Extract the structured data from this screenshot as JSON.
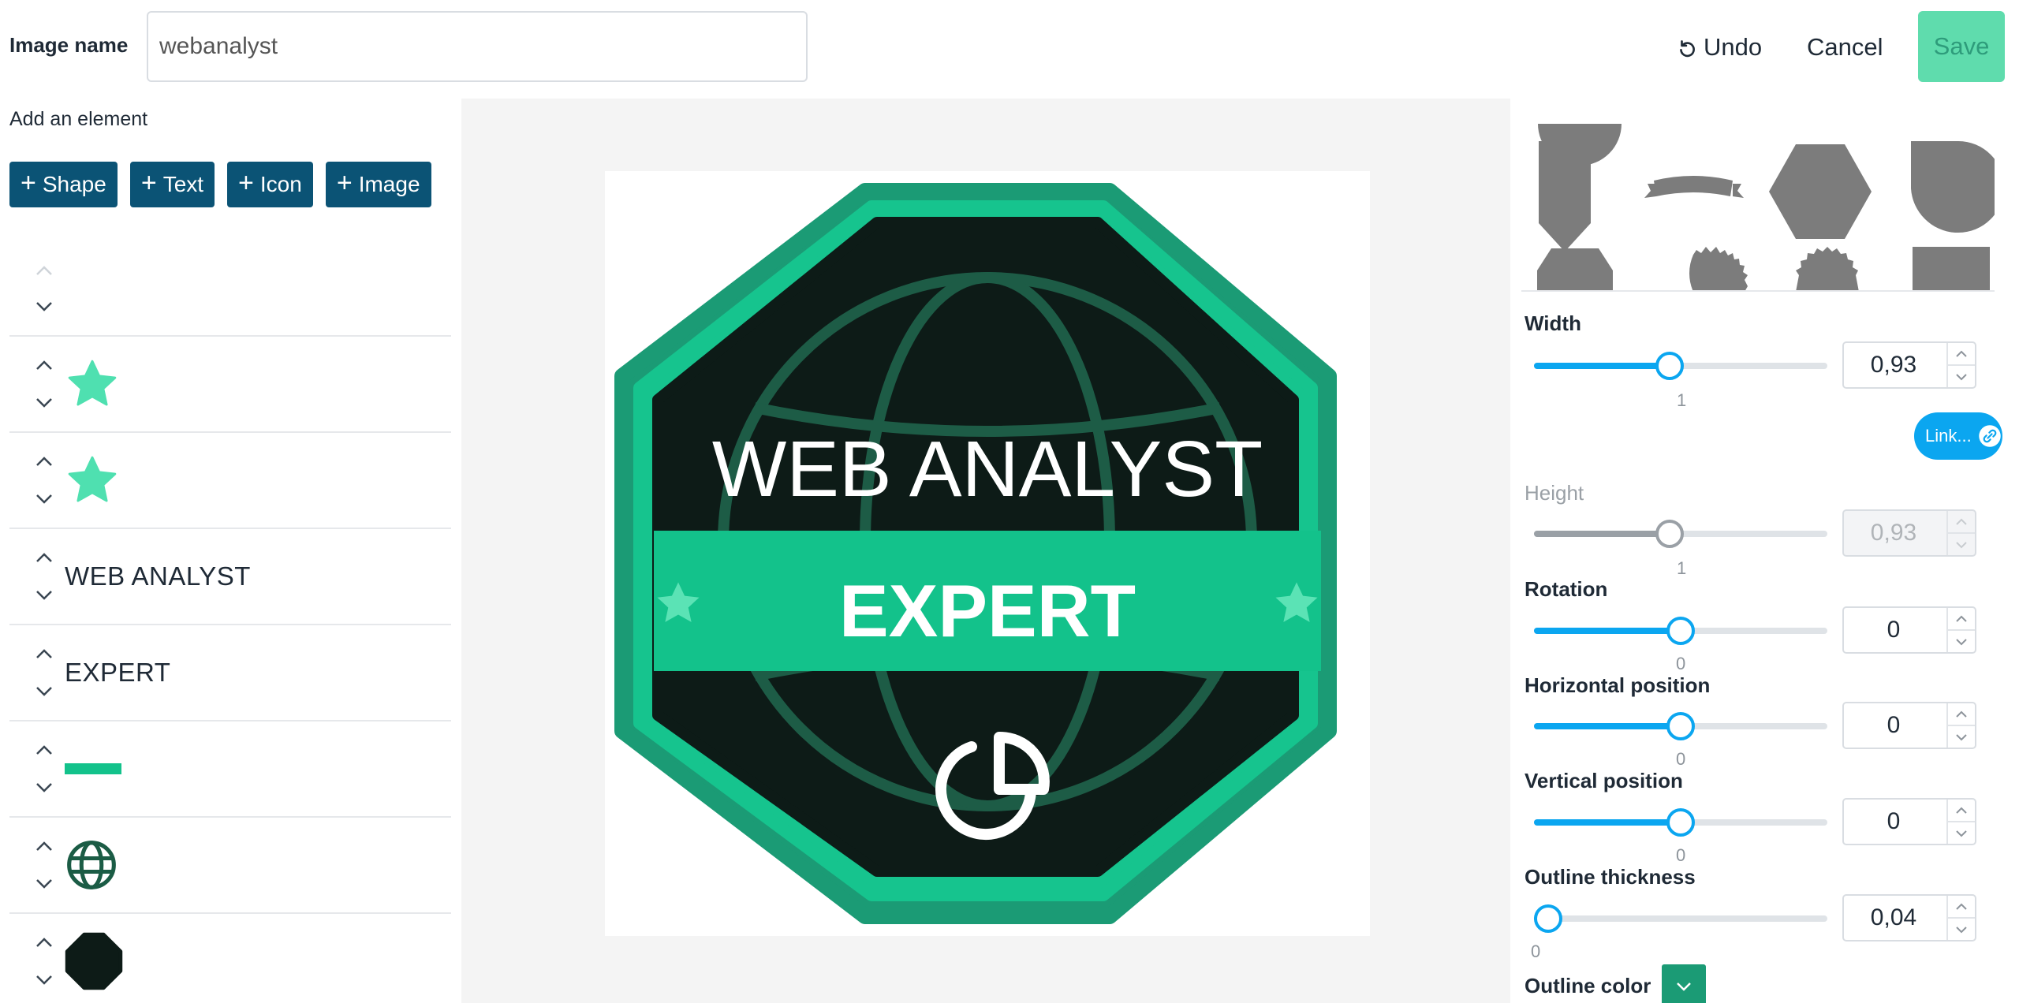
{
  "header": {
    "image_name_label": "Image name",
    "image_name_value": "webanalyst",
    "undo_label": "Undo",
    "cancel_label": "Cancel",
    "save_label": "Save"
  },
  "left_panel": {
    "add_label": "Add an element",
    "add_buttons": [
      "Shape",
      "Text",
      "Icon",
      "Image"
    ],
    "layers": [
      {
        "type": "empty",
        "text": ""
      },
      {
        "type": "star-icon",
        "text": ""
      },
      {
        "type": "star-icon",
        "text": ""
      },
      {
        "type": "text",
        "text": "WEB ANALYST"
      },
      {
        "type": "text",
        "text": "EXPERT"
      },
      {
        "type": "bar-shape",
        "text": ""
      },
      {
        "type": "globe-icon",
        "text": ""
      },
      {
        "type": "octagon-shape",
        "text": ""
      }
    ]
  },
  "badge": {
    "title": "WEB ANALYST",
    "ribbon_text": "EXPERT",
    "colors": {
      "outer_ring": "#1b9b75",
      "inner_ring": "#16c48e",
      "body": "#0d1b17",
      "globe_lines": "#1d5c46",
      "ribbon": "#13c28b",
      "ribbon_stars": "#5be3b5"
    }
  },
  "right_panel": {
    "width": {
      "label": "Width",
      "value": "0,93",
      "tick": "1",
      "fill_fraction": 0.29
    },
    "link_label": "Link...",
    "height": {
      "label": "Height",
      "value": "0,93",
      "tick": "1",
      "fill_fraction": 0.29
    },
    "rotation": {
      "label": "Rotation",
      "value": "0",
      "tick": "0",
      "fill_fraction": 0.31
    },
    "horizontal": {
      "label": "Horizontal position",
      "value": "0",
      "tick": "0",
      "fill_fraction": 0.31
    },
    "vertical": {
      "label": "Vertical position",
      "value": "0",
      "tick": "0",
      "fill_fraction": 0.31
    },
    "outline_thickness": {
      "label": "Outline thickness",
      "value": "0,04",
      "tick": "0",
      "fill_fraction": 0.04
    },
    "outline_color_label": "Outline color",
    "outline_color": "#1b9b75",
    "accent_color": "#0ba6f0"
  }
}
